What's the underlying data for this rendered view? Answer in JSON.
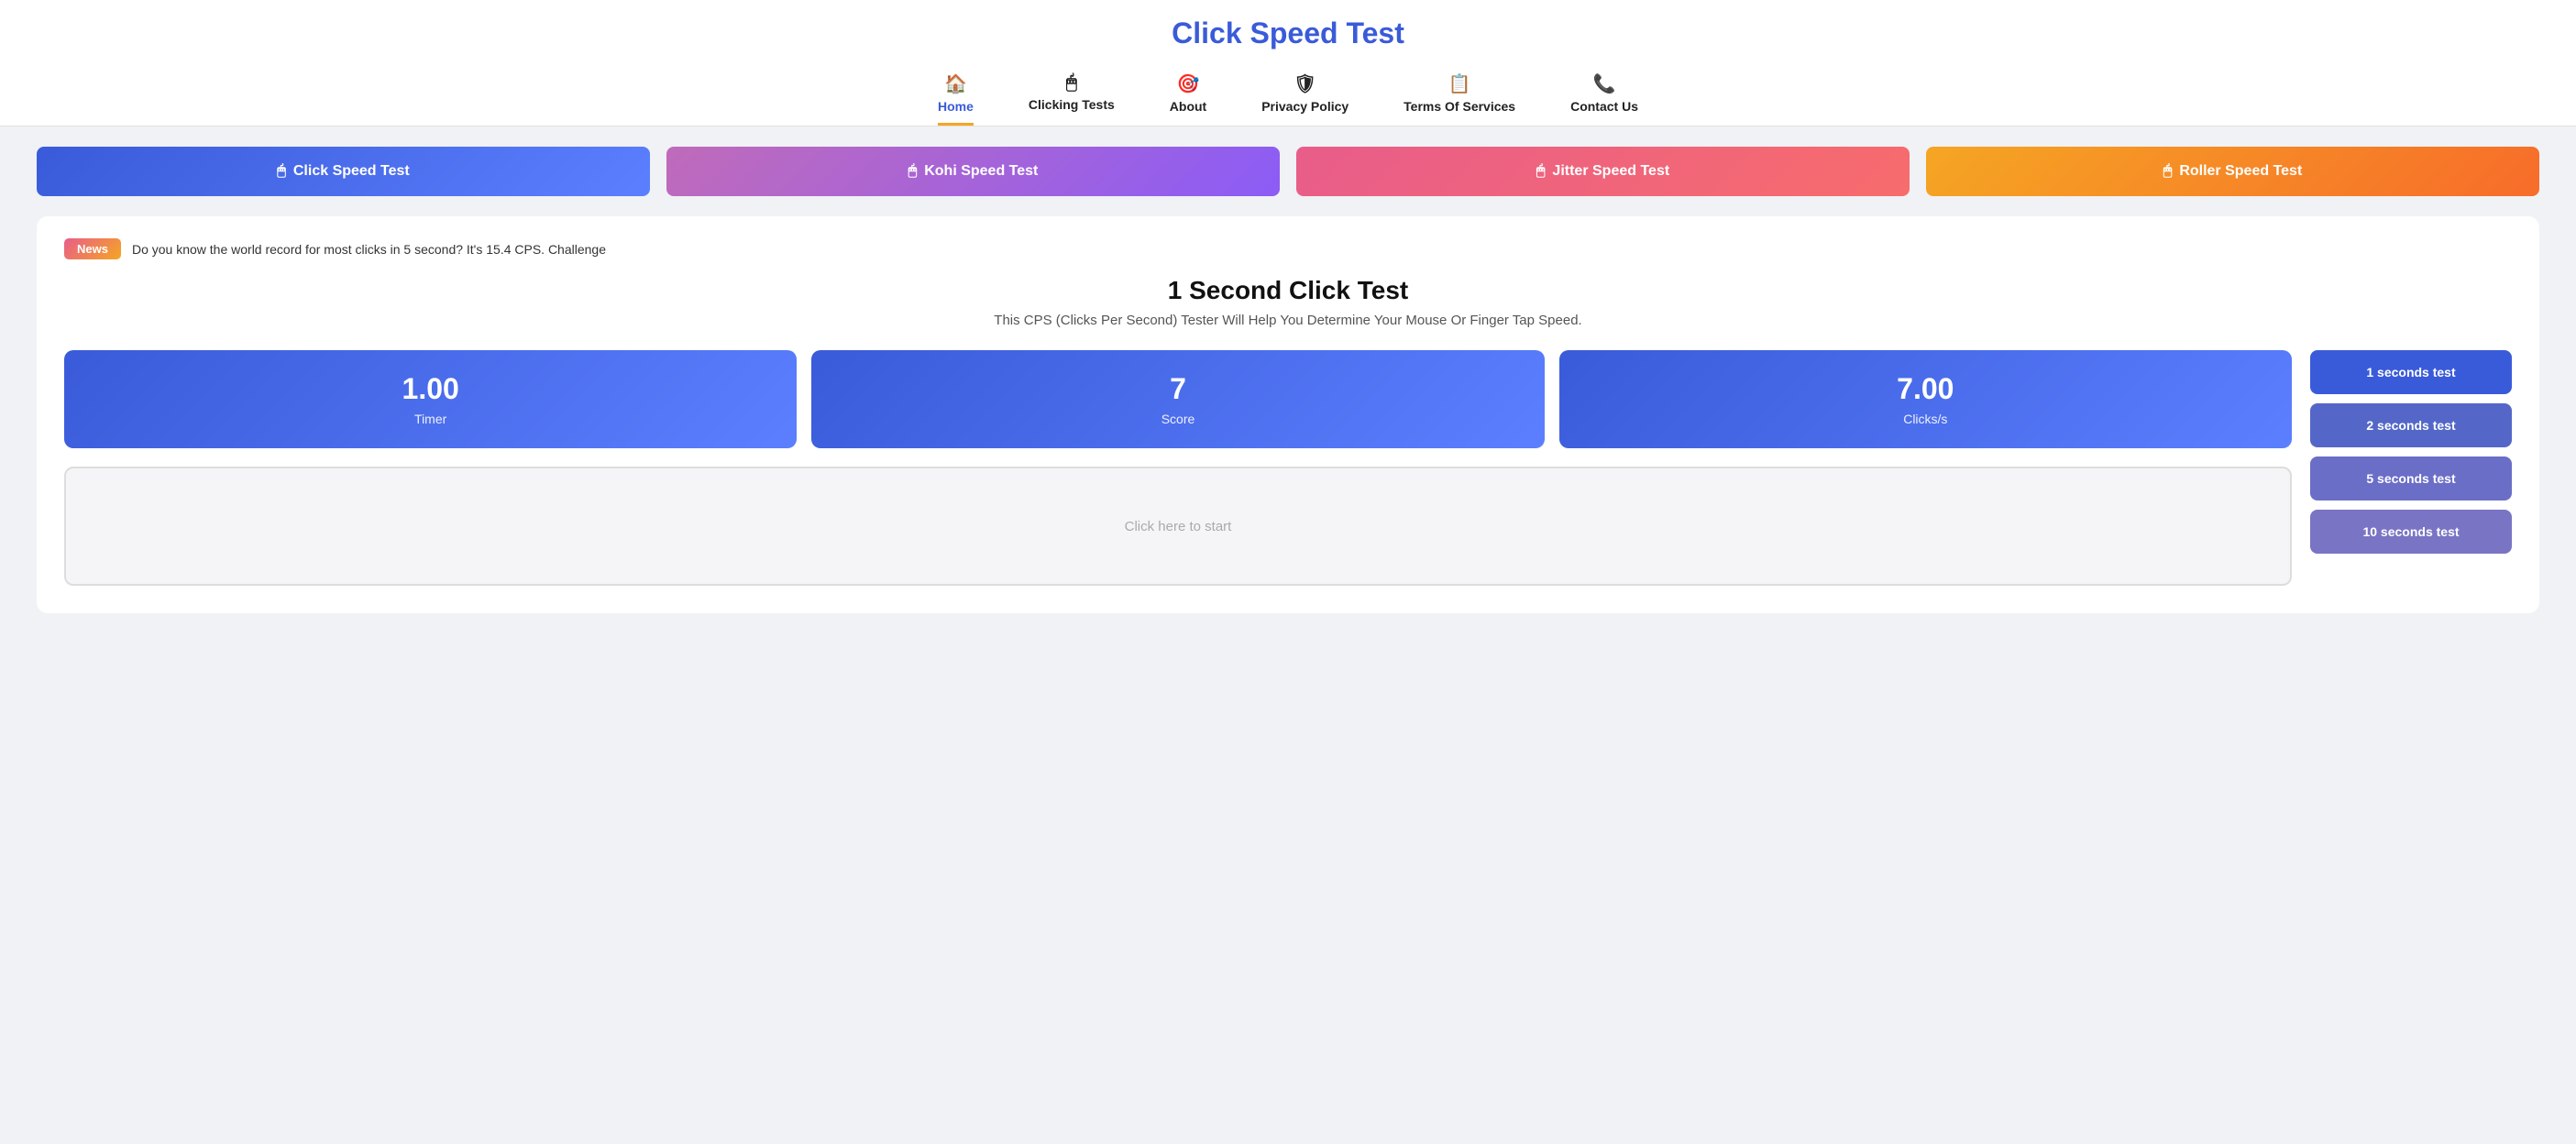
{
  "header": {
    "title": "Click Speed Test",
    "nav": [
      {
        "id": "home",
        "label": "Home",
        "icon": "🏠",
        "active": true
      },
      {
        "id": "clicking-tests",
        "label": "Clicking Tests",
        "icon": "🖱",
        "active": false
      },
      {
        "id": "about",
        "label": "About",
        "icon": "🎯",
        "active": false
      },
      {
        "id": "privacy",
        "label": "Privacy Policy",
        "icon": "🛡",
        "active": false
      },
      {
        "id": "terms",
        "label": "Terms Of Services",
        "icon": "📋",
        "active": false
      },
      {
        "id": "contact",
        "label": "Contact Us",
        "icon": "📞",
        "active": false
      }
    ]
  },
  "subnav": [
    {
      "id": "click-speed",
      "label": "Click Speed Test",
      "style": "click-speed"
    },
    {
      "id": "kohi-speed",
      "label": "Kohi Speed Test",
      "style": "kohi-speed"
    },
    {
      "id": "jitter-speed",
      "label": "Jitter Speed Test",
      "style": "jitter-speed"
    },
    {
      "id": "roller-speed",
      "label": "Roller Speed Test",
      "style": "roller-speed"
    }
  ],
  "news": {
    "badge": "News",
    "text": "Do you know the world record for most clicks in 5 second? It's 15.4 CPS. Challenge"
  },
  "main": {
    "page_title": "1 Second Click Test",
    "subtitle": "This CPS (Clicks Per Second) Tester Will Help You Determine Your Mouse Or Finger Tap Speed.",
    "stats": [
      {
        "id": "timer",
        "value": "1.00",
        "label": "Timer"
      },
      {
        "id": "score",
        "value": "7",
        "label": "Score"
      },
      {
        "id": "clicks",
        "value": "7.00",
        "label": "Clicks/s"
      }
    ]
  },
  "sidebar_tests": [
    {
      "id": "1s",
      "label": "1 seconds test",
      "style": "test-btn-1"
    },
    {
      "id": "2s",
      "label": "2 seconds test",
      "style": "test-btn-2"
    },
    {
      "id": "5s",
      "label": "5 seconds test",
      "style": "test-btn-5"
    },
    {
      "id": "10s",
      "label": "10 seconds test",
      "style": "test-btn-10"
    }
  ],
  "click_area_placeholder": "Click here to start"
}
